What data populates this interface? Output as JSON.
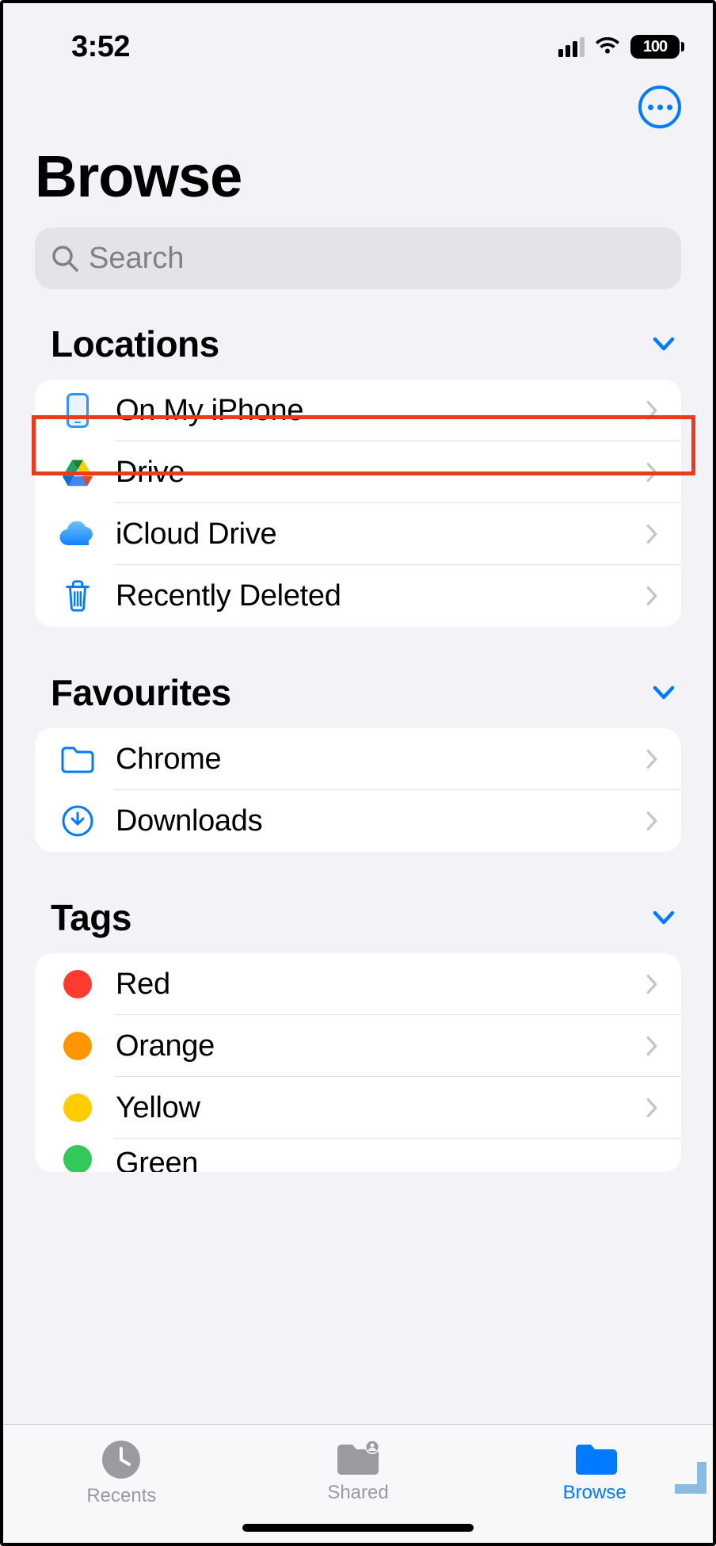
{
  "status": {
    "time": "3:52",
    "battery": "100"
  },
  "header": {
    "title": "Browse"
  },
  "search": {
    "placeholder": "Search"
  },
  "sections": {
    "locations": {
      "title": "Locations",
      "items": [
        {
          "label": "On My iPhone",
          "icon": "iphone"
        },
        {
          "label": "Drive",
          "icon": "google-drive"
        },
        {
          "label": "iCloud Drive",
          "icon": "icloud"
        },
        {
          "label": "Recently Deleted",
          "icon": "trash"
        }
      ]
    },
    "favourites": {
      "title": "Favourites",
      "items": [
        {
          "label": "Chrome",
          "icon": "folder"
        },
        {
          "label": "Downloads",
          "icon": "download"
        }
      ]
    },
    "tags": {
      "title": "Tags",
      "items": [
        {
          "label": "Red",
          "color": "#ff3b30"
        },
        {
          "label": "Orange",
          "color": "#ff9500"
        },
        {
          "label": "Yellow",
          "color": "#ffcc00"
        },
        {
          "label": "Green",
          "color": "#34c759"
        }
      ]
    }
  },
  "tabs": {
    "recents": "Recents",
    "shared": "Shared",
    "browse": "Browse"
  },
  "highlighted_row_index": 1
}
